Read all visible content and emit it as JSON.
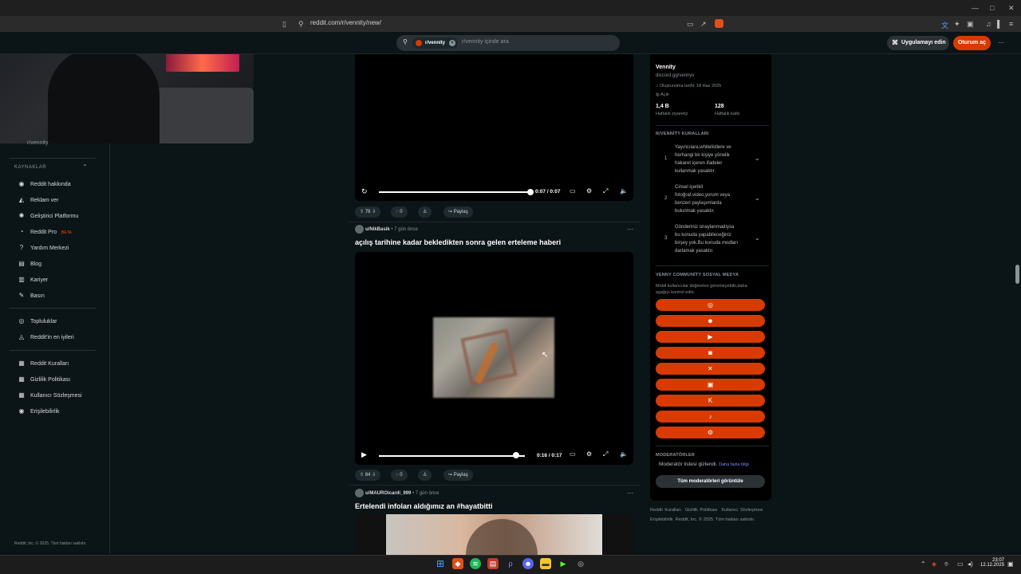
{
  "browser": {
    "url": "reddit.com/r/vennity/new/",
    "window_controls": [
      "—",
      "□",
      "✕"
    ]
  },
  "header": {
    "search_chip": "r/vennity",
    "search_placeholder": "r/vennity içinde ara",
    "app_button": "Uygulamayı edin",
    "login_button": "Oturum aç",
    "more": "···"
  },
  "sidebar": {
    "partial_item": "r/vennity",
    "section_title": "KAYNAKLAR",
    "resources": [
      {
        "label": "Reddit hakkında",
        "icon": "reddit-icon"
      },
      {
        "label": "Reklam ver",
        "icon": "megaphone-icon"
      },
      {
        "label": "Geliştirici Platformu",
        "icon": "gear-icon"
      },
      {
        "label": "Reddit Pro",
        "icon": "pro-icon",
        "badge": "BETA"
      },
      {
        "label": "Yardım Merkezi",
        "icon": "help-icon"
      },
      {
        "label": "Blog",
        "icon": "book-icon"
      },
      {
        "label": "Kariyer",
        "icon": "briefcase-icon"
      },
      {
        "label": "Basın",
        "icon": "press-icon"
      }
    ],
    "communities": [
      {
        "label": "Topluluklar",
        "icon": "communities-icon"
      },
      {
        "label": "Reddit'in en iyileri",
        "icon": "best-icon"
      }
    ],
    "legal": [
      {
        "label": "Reddit Kuralları",
        "icon": "rules-icon"
      },
      {
        "label": "Gizlilik Politikası",
        "icon": "privacy-icon"
      },
      {
        "label": "Kullanıcı Sözleşmesi",
        "icon": "agreement-icon"
      },
      {
        "label": "Erişilebilirlik",
        "icon": "accessibility-icon"
      }
    ],
    "footer": "Reddit, Inc. © 2025. Tüm hakları saklıdır."
  },
  "posts": [
    {
      "time": "0:07 / 0:07",
      "votes": "78",
      "comments": "0",
      "share": "Paylaş",
      "progress": 1.0
    },
    {
      "author": "u/NikBasik",
      "ago": "• 7 gün önce",
      "title": "açılış tarihine kadar bekledikten sonra gelen erteleme haberi",
      "time": "0:16 / 0:17",
      "votes": "84",
      "comments": "0",
      "share": "Paylaş",
      "progress": 0.94
    },
    {
      "author": "u/MAUROicardi_999",
      "ago": "• 7 gün önce",
      "title": "Ertelendi infoları aldığımız an #hayatbitti"
    }
  ],
  "community": {
    "name": "Vennity",
    "discord": "discord.gg/vennyv",
    "created": "Oluşturulma tarihi: 18 Haz 2025",
    "visibility": "Açık",
    "stats": [
      {
        "value": "1,4 B",
        "label": "Haftalık ziyaretçi"
      },
      {
        "value": "128",
        "label": "Haftalık katkı"
      }
    ],
    "rules_title": "R/VENNİTY KURALLARI",
    "rules": [
      {
        "num": "1",
        "lines": [
          "Yayıncılara,whitelistlere ve",
          "herhangi bir kişiye yönelik",
          "hakaret içeren ifadeler",
          "kullanmak yasaktır."
        ]
      },
      {
        "num": "2",
        "lines": [
          "Cinsel içerikli",
          "fotoğraf,video,yorum veya",
          "benzeri paylaşımlarda",
          "bulunmak yasaktır."
        ]
      },
      {
        "num": "3",
        "lines": [
          "Gönderiniz onaylanmadıysa",
          "bu konuda yapabileceğiniz",
          "birşey yok.Bu konuda modları",
          "darlamak yasaktır."
        ]
      }
    ],
    "social_title": "VENNY COMMUNİTY SOSYAL MEDYA",
    "social_note_1": "Mobil kullanıcılar düğmeleri göremeyebilir,daha",
    "social_note_2": "aşağıyı kontrol edin.",
    "social_buttons": [
      {
        "icon": "globe-icon",
        "glyph": "◎"
      },
      {
        "icon": "discord-icon",
        "glyph": "☻"
      },
      {
        "icon": "youtube-icon",
        "glyph": "▶"
      },
      {
        "icon": "instagram-icon",
        "glyph": "◙"
      },
      {
        "icon": "x-icon",
        "glyph": "✕"
      },
      {
        "icon": "twitch-icon",
        "glyph": "▣"
      },
      {
        "icon": "kick-icon",
        "glyph": "K"
      },
      {
        "icon": "tiktok-icon",
        "glyph": "♪"
      },
      {
        "icon": "steam-icon",
        "glyph": "⚙"
      }
    ],
    "mods_title": "MODERATÖRLER",
    "mods_hidden": "Moderatör listesi gizlendi.",
    "mods_link": "Daha fazla bilgi",
    "mods_button": "Tüm moderatörleri görüntüle"
  },
  "rfooter": {
    "links": [
      "Reddit Kuralları",
      "Gizlilik Politikası",
      "Kullanıcı Sözleşmesi"
    ],
    "line2_link": "Erişilebilirlik",
    "copyright": "Reddit, Inc. © 2025. Tüm hakları saklıdır."
  },
  "taskbar": {
    "time": "23:07",
    "date": "12.12.2025"
  }
}
